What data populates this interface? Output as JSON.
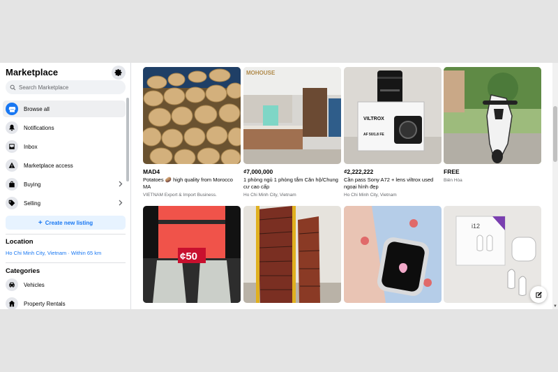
{
  "sidebar": {
    "title": "Marketplace",
    "search_placeholder": "Search Marketplace",
    "items": [
      {
        "label": "Browse all",
        "icon": "storefront-icon"
      },
      {
        "label": "Notifications",
        "icon": "bell-icon"
      },
      {
        "label": "Inbox",
        "icon": "inbox-icon"
      },
      {
        "label": "Marketplace access",
        "icon": "warning-icon"
      },
      {
        "label": "Buying",
        "icon": "shopping-bag-icon"
      },
      {
        "label": "Selling",
        "icon": "tag-icon"
      }
    ],
    "create_listing": "Create new listing",
    "location_title": "Location",
    "location_value": "Ho Chi Minh City, Vietnam · Within 65 km",
    "categories_title": "Categories",
    "categories": [
      {
        "label": "Vehicles",
        "icon": "car-icon"
      },
      {
        "label": "Property Rentals",
        "icon": "house-icon"
      }
    ]
  },
  "listings": [
    {
      "price": "MAD4",
      "title": "Potatoes 🥔 high quality from Morocco MA",
      "location": "VIETNAM Export & Import Business."
    },
    {
      "price": "₫7,000,000",
      "title": "1 phòng ngủ 1 phòng tắm Căn hộ/Chung cư cao cấp",
      "location": "Ho Chi Minh City, Vietnam",
      "image_text": "MOHOUSE"
    },
    {
      "price": "₫2,222,222",
      "title": "Cần pass Sony A72 + lens viltrox used ngoại hình đẹp",
      "location": "Ho Chi Minh City, Vietnam",
      "image_text": "VILTROX",
      "image_text2": "AF 50/1.8 FE"
    },
    {
      "price": "FREE",
      "title": "",
      "location": "Biên Hòa"
    },
    {
      "image_text": "¢50"
    },
    {},
    {},
    {
      "image_text": "i12"
    }
  ],
  "colors": {
    "accent": "#1877f2",
    "secondary_text": "#65676b",
    "sidebar_active": "#eeeff1"
  }
}
